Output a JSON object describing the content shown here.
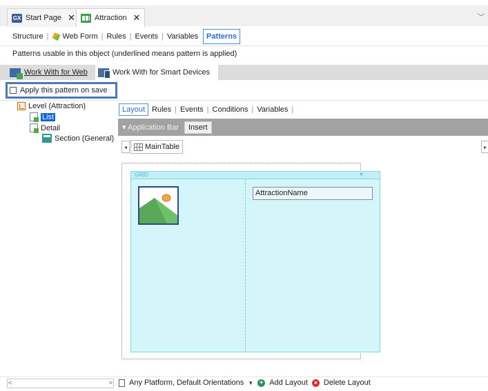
{
  "doc_tabs": [
    {
      "label": "Start Page",
      "icon": "gx-icon",
      "active": false
    },
    {
      "label": "Attraction",
      "icon": "transaction-icon",
      "active": true
    }
  ],
  "object_tabs": [
    {
      "label": "Structure"
    },
    {
      "label": "Web Form"
    },
    {
      "label": "Rules"
    },
    {
      "label": "Events"
    },
    {
      "label": "Variables"
    },
    {
      "label": "Patterns",
      "selected": true
    }
  ],
  "patterns_description": "Patterns usable in this object (underlined means pattern is applied)",
  "pattern_tabs": [
    {
      "label": "Work With for Web"
    },
    {
      "label": "Work With for Smart Devices",
      "selected": true
    }
  ],
  "apply_checkbox": {
    "label": "Apply this pattern on save",
    "checked": false
  },
  "tree": {
    "level": "Level (Attraction)",
    "list": "List",
    "detail": "Detail",
    "section": "Section (General)"
  },
  "sub_tabs": [
    {
      "label": "Layout",
      "selected": true
    },
    {
      "label": "Rules"
    },
    {
      "label": "Events"
    },
    {
      "label": "Conditions"
    },
    {
      "label": "Variables"
    }
  ],
  "app_bar": {
    "label": "Application Bar",
    "insert_label": "Insert"
  },
  "main_table": "MainTable",
  "grid": {
    "label": "GRID",
    "attribute": "AttractionName"
  },
  "bottom": {
    "platform": "Any Platform, Default Orientations",
    "add_layout": "Add Layout",
    "delete_layout": "Delete Layout"
  },
  "colors": {
    "accent": "#2e6fc0",
    "grid_bg": "#d4f6fb",
    "selection": "#0b64d6"
  }
}
